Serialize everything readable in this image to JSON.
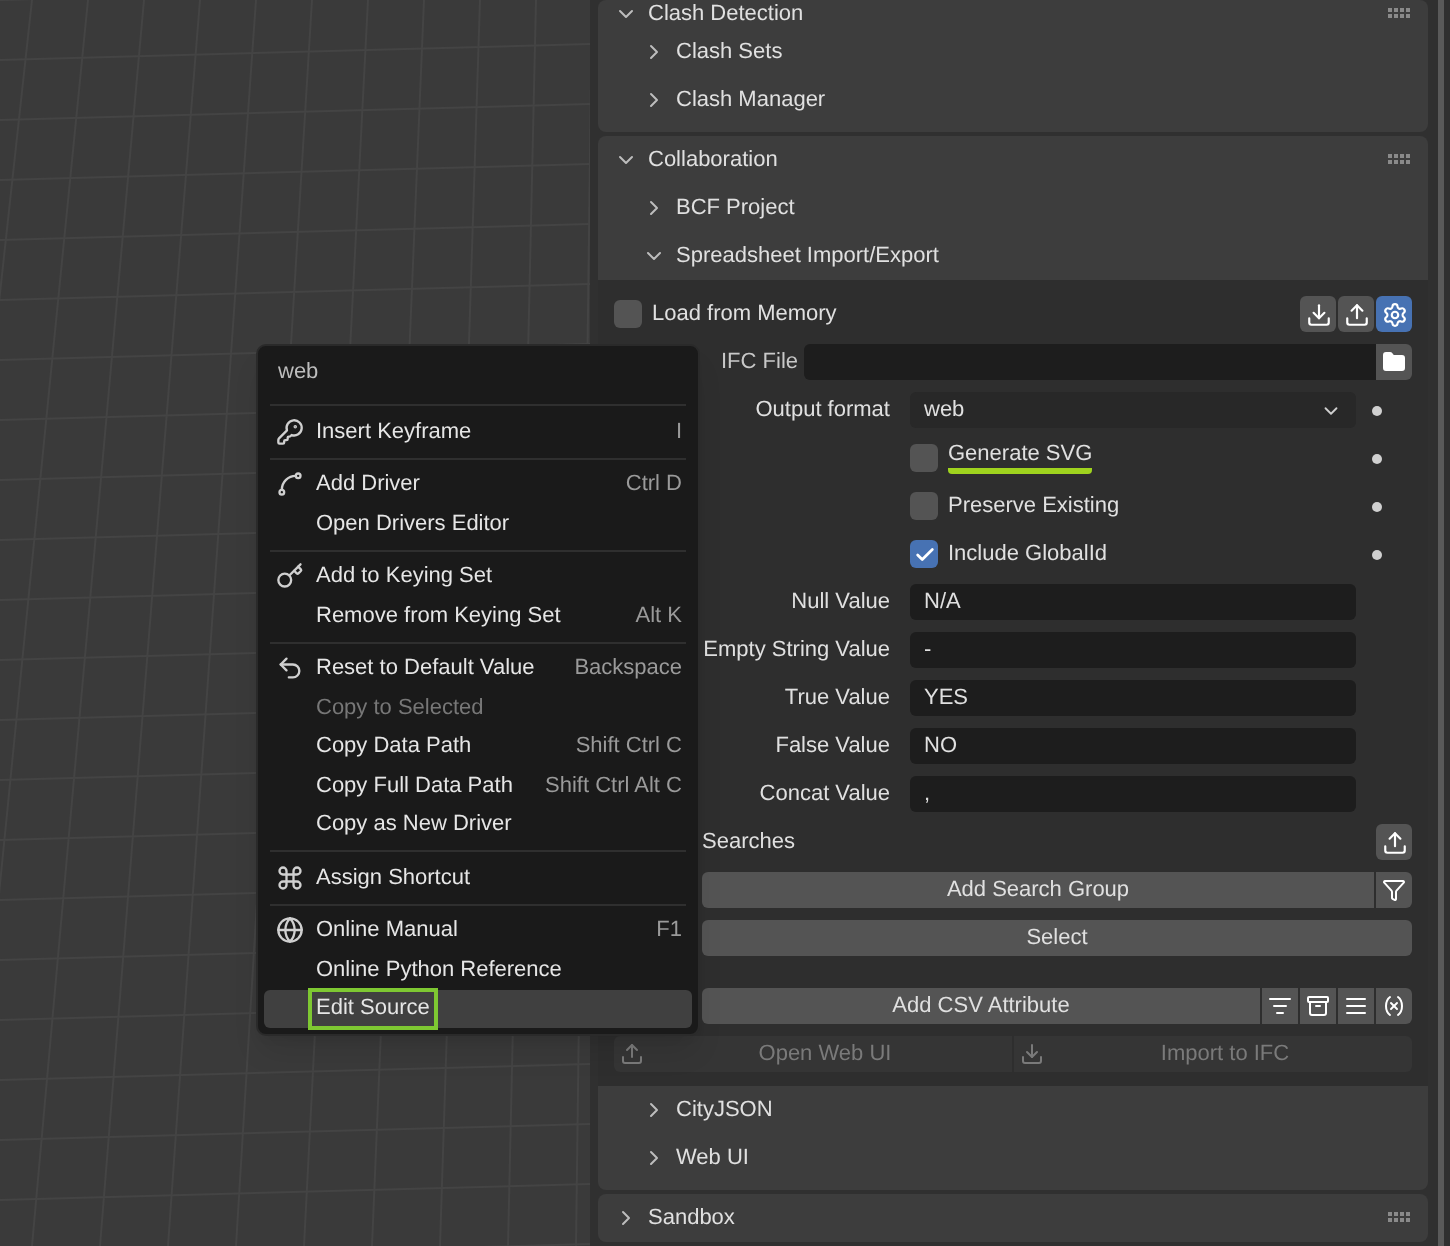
{
  "sections": [
    {
      "title": "Clash Detection",
      "expanded": true,
      "children": [
        {
          "title": "Clash Sets",
          "expanded": false
        },
        {
          "title": "Clash Manager",
          "expanded": false
        }
      ]
    },
    {
      "title": "Collaboration",
      "expanded": true,
      "children": [
        {
          "title": "BCF Project",
          "expanded": false
        },
        {
          "title": "Spreadsheet Import/Export",
          "expanded": true
        },
        {
          "title": "CityJSON",
          "expanded": false
        },
        {
          "title": "Web UI",
          "expanded": false
        }
      ]
    },
    {
      "title": "Sandbox",
      "expanded": false
    }
  ],
  "spreadsheet": {
    "load_from_memory": {
      "label": "Load from Memory",
      "checked": false
    },
    "toolbar_buttons": [
      {
        "kind": "download",
        "selected": false
      },
      {
        "kind": "upload",
        "selected": false
      },
      {
        "kind": "settings",
        "selected": true
      }
    ],
    "ifc_file": {
      "label": "IFC File"
    },
    "output_format": {
      "label": "Output format",
      "value": "web"
    },
    "options": [
      {
        "label": "Generate SVG",
        "checked": false,
        "highlighted": true
      },
      {
        "label": "Preserve Existing",
        "checked": false,
        "highlighted": false
      },
      {
        "label": "Include GlobalId",
        "checked": true,
        "highlighted": false
      }
    ],
    "values": [
      {
        "label": "Null Value",
        "value": "N/A"
      },
      {
        "label": "Empty String Value",
        "value": "-"
      },
      {
        "label": "True Value",
        "value": "YES"
      },
      {
        "label": "False Value",
        "value": "NO"
      },
      {
        "label": "Concat Value",
        "value": ","
      }
    ],
    "searches_label": "Searches",
    "add_search_group": "Add Search Group",
    "select": "Select",
    "add_csv_attribute": "Add CSV Attribute",
    "csv_tools": [
      {
        "kind": "sort"
      },
      {
        "kind": "archive"
      },
      {
        "kind": "list"
      },
      {
        "kind": "variable"
      }
    ],
    "bottom_buttons": [
      {
        "label": "Open Web UI",
        "kind": "upload",
        "disabled": true
      },
      {
        "label": "Import to IFC",
        "kind": "download",
        "disabled": true
      }
    ]
  },
  "context_menu": {
    "title": "web",
    "groups": [
      [
        {
          "label": "Insert Keyframe",
          "shortcut": "I",
          "kind": "keyframe",
          "disabled": false,
          "selected": false,
          "outlined": false
        }
      ],
      [
        {
          "label": "Add Driver",
          "shortcut": "Ctrl D",
          "kind": "driver",
          "disabled": false,
          "selected": false,
          "outlined": false
        },
        {
          "label": "Open Drivers Editor",
          "disabled": false,
          "selected": false,
          "outlined": false
        }
      ],
      [
        {
          "label": "Add to Keying Set",
          "kind": "keying",
          "disabled": false,
          "selected": false,
          "outlined": false
        },
        {
          "label": "Remove from Keying Set",
          "shortcut": "Alt K",
          "disabled": false,
          "selected": false,
          "outlined": false
        }
      ],
      [
        {
          "label": "Reset to Default Value",
          "shortcut": "Backspace",
          "kind": "reset",
          "disabled": false,
          "selected": false,
          "outlined": false
        },
        {
          "label": "Copy to Selected",
          "disabled": true,
          "selected": false,
          "outlined": false
        },
        {
          "label": "Copy Data Path",
          "shortcut": "Shift Ctrl C",
          "disabled": false,
          "selected": false,
          "outlined": false
        },
        {
          "label": "Copy Full Data Path",
          "shortcut": "Shift Ctrl Alt C",
          "disabled": false,
          "selected": false,
          "outlined": false
        },
        {
          "label": "Copy as New Driver",
          "disabled": false,
          "selected": false,
          "outlined": false
        }
      ],
      [
        {
          "label": "Assign Shortcut",
          "kind": "shortcut",
          "disabled": false,
          "selected": false,
          "outlined": false
        }
      ],
      [
        {
          "label": "Online Manual",
          "shortcut": "F1",
          "kind": "globe",
          "disabled": false,
          "selected": false,
          "outlined": false
        },
        {
          "label": "Online Python Reference",
          "disabled": false,
          "selected": false,
          "outlined": false
        },
        {
          "label": "Edit Source",
          "disabled": false,
          "selected": true,
          "outlined": true
        }
      ]
    ]
  }
}
